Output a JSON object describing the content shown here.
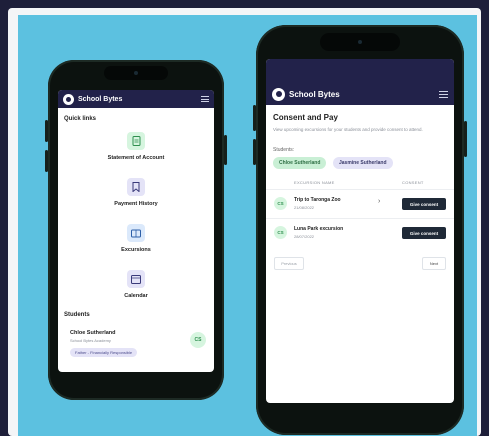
{
  "app": {
    "name": "School Bytes"
  },
  "quick_links": {
    "title": "Quick links",
    "items": [
      {
        "label": "Statement of Account",
        "icon": "document-icon"
      },
      {
        "label": "Payment History",
        "icon": "bookmark-icon"
      },
      {
        "label": "Excursions",
        "icon": "book-icon"
      },
      {
        "label": "Calendar",
        "icon": "calendar-icon"
      }
    ]
  },
  "students_section": {
    "title": "Students",
    "student": {
      "name": "Chloe Sutherland",
      "school": "School Bytes Academy",
      "role": "Father - Financially Responsible",
      "initials": "CS"
    }
  },
  "consent": {
    "title": "Consent and Pay",
    "description": "View upcoming excursions for your students and provide consent to attend.",
    "students_label": "Students:",
    "chips": [
      {
        "label": "Chloe Sutherland",
        "active": true
      },
      {
        "label": "Jasmine Sutherland",
        "active": false
      }
    ],
    "columns": {
      "name": "EXCURSION NAME",
      "consent": "CONSENT"
    },
    "rows": [
      {
        "initials": "CS",
        "name": "Trip to Taronga Zoo",
        "date": "21/08/2022",
        "action": "Give consent"
      },
      {
        "initials": "CS",
        "name": "Luna Park excursion",
        "date": "28/07/2022",
        "action": "Give consent"
      }
    ],
    "pagination": {
      "previous": "Previous",
      "next": "Next"
    }
  },
  "colors": {
    "navy": "#22224a",
    "sky": "#5cc1e0",
    "green_tint": "#d6f5df",
    "purple_tint": "#e4e3f7",
    "button_dark": "#1f2937"
  }
}
